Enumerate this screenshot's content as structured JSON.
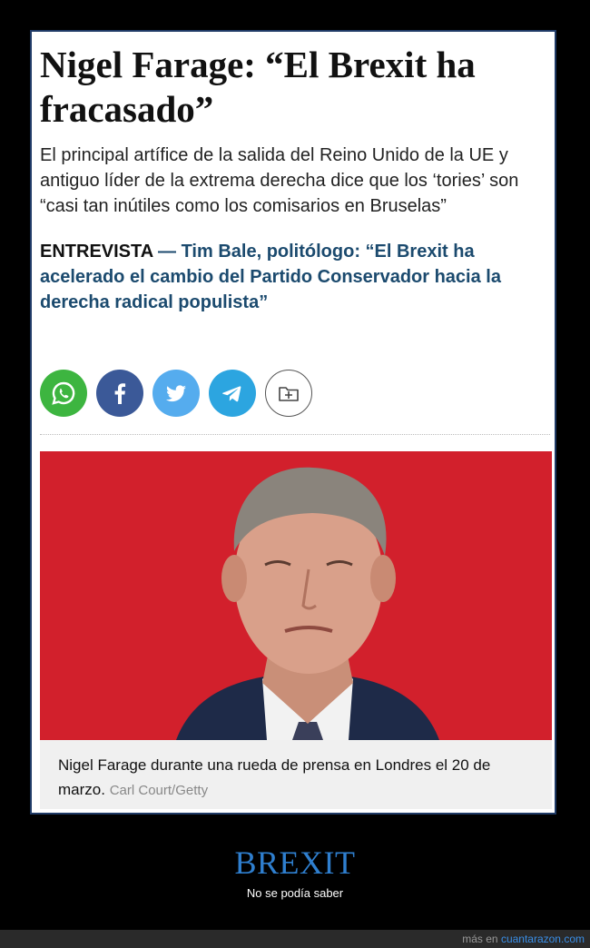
{
  "article": {
    "headline": "Nigel Farage: “El Brexit ha fracasado”",
    "subheadline": "El principal artífice de la salida del Reino Unido de la UE y antiguo líder de la extrema derecha dice que los ‘tories’ son “casi tan inútiles como los comisarios en Bruselas”",
    "related": {
      "kicker": "ENTREVISTA",
      "dash": " — ",
      "title": "Tim Bale, politólogo: “El Brexit ha acelerado el cambio del Partido Conservador hacia la derecha radical populista”"
    },
    "share_buttons": [
      {
        "icon": "whatsapp-icon",
        "color": "#3db540"
      },
      {
        "icon": "facebook-icon",
        "color": "#3b5998"
      },
      {
        "icon": "twitter-icon",
        "color": "#55acee"
      },
      {
        "icon": "telegram-icon",
        "color": "#2ca5e0"
      },
      {
        "icon": "save-folder-icon",
        "color": "#ffffff"
      }
    ],
    "photo": {
      "caption": "Nigel Farage durante una rueda de prensa en Londres el 20 de marzo.",
      "credit": "Carl Court/Getty"
    }
  },
  "meme": {
    "title": "BREXIT",
    "subtitle": "No se podía saber",
    "title_color": "#2f7fcf"
  },
  "footer": {
    "prefix": "más en ",
    "site": "cuantarazon.com"
  }
}
